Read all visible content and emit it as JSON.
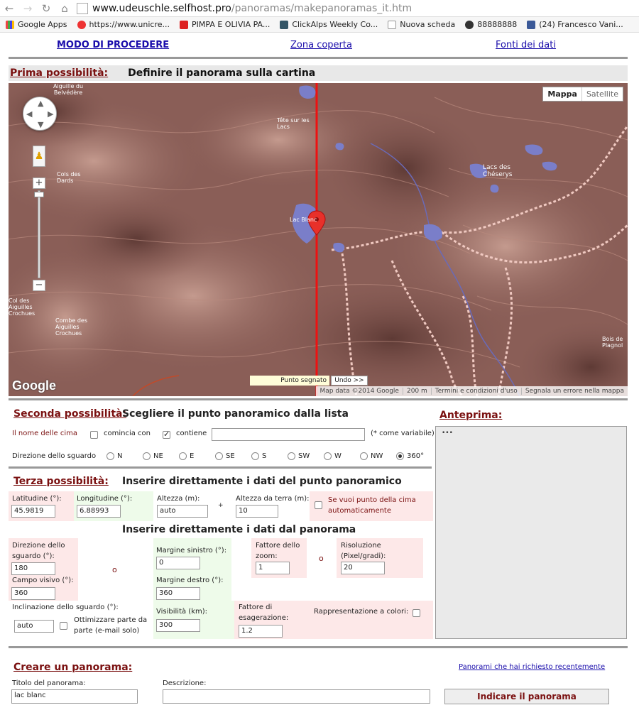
{
  "browser": {
    "url_host": "www.udeuschle.selfhost.pro",
    "url_path": "/panoramas/makepanoramas_it.htm",
    "bookmarks": [
      {
        "label": "Google Apps",
        "icon": "apps-grid-icon",
        "color": "#e44"
      },
      {
        "label": "https://www.unicre...",
        "icon": "no-entry-icon",
        "color": "#e33"
      },
      {
        "label": "PIMPA E OLIVIA PA...",
        "icon": "youtube-icon",
        "color": "#d22"
      },
      {
        "label": "ClickAlps Weekly Co...",
        "icon": "bookmark-icon",
        "color": "#356"
      },
      {
        "label": "Nuova scheda",
        "icon": "page-icon",
        "color": "#ccc"
      },
      {
        "label": "88888888",
        "icon": "circle-icon",
        "color": "#333"
      },
      {
        "label": "(24) Francesco Vani...",
        "icon": "facebook-icon",
        "color": "#3b5998"
      }
    ]
  },
  "topnav": {
    "link1": "MODO DI PROCEDERE",
    "link2": "Zona coperta",
    "link3": "Fonti dei dati"
  },
  "section1": {
    "title": "Prima possibilità:",
    "subtitle": "Definire il panorama sulla cartina"
  },
  "map": {
    "type_map": "Mappa",
    "type_satellite": "Satellite",
    "logo": "Google",
    "punto_segnato": "Punto segnato",
    "undo": "Undo >>",
    "attribution": [
      "Map data ©2014 Google",
      "200 m",
      "Termini e condizioni d'uso",
      "Segnala un errore nella mappa"
    ],
    "place_labels": [
      {
        "text": "Aiguille du Belvédère"
      },
      {
        "text": "Tête sur les Lacs"
      },
      {
        "text": "Cols des Dards"
      },
      {
        "text": "Lacs des Chéserys"
      },
      {
        "text": "Lac Blanc"
      },
      {
        "text": "Col des Aiguilles Crochues"
      },
      {
        "text": "Combe des Aiguilles Crochues"
      },
      {
        "text": "Bois de Plagnol"
      }
    ]
  },
  "section2": {
    "title": "Seconda possibilità:",
    "subtitle": "Scegliere il punto panoramico dalla lista",
    "name_label": "Il nome delle cima",
    "opt_starts": "comincia con",
    "opt_contains": "contiene",
    "wildcard_hint": "(* come variabile)",
    "direction_label": "Direzione dello sguardo",
    "directions": [
      "N",
      "NE",
      "E",
      "SE",
      "S",
      "SW",
      "W",
      "NW",
      "360°"
    ],
    "selected_direction": "360°"
  },
  "preview": {
    "title": "Anteprima:"
  },
  "section3": {
    "title": "Terza possibilità:",
    "subtitle": "Inserire direttamente i dati del punto panoramico",
    "lat_label": "Latitudine (°):",
    "lat_value": "45.9819",
    "lon_label": "Longitudine (°):",
    "lon_value": "6.88993",
    "alt_label": "Altezza (m):",
    "alt_value": "auto",
    "plus": "+",
    "ground_label": "Altezza da terra (m):",
    "ground_value": "10",
    "auto_peak_label": "Se vuoi punto della cima automaticamente",
    "subtitle2": "Inserire direttamente i dati dal panorama",
    "dir_label": "Direzione dello sguardo (°):",
    "dir_value": "180",
    "fov_label": "Campo visivo (°):",
    "fov_value": "360",
    "or1": "o",
    "margin_left_label": "Margine sinistro (°):",
    "margin_left_value": "0",
    "margin_right_label": "Margine destro (°):",
    "margin_right_value": "360",
    "zoom_label": "Fattore dello zoom:",
    "zoom_value": "1",
    "or2": "o",
    "res_label": "Risoluzione (Pixel/gradi):",
    "res_value": "20",
    "incl_label": "Inclinazione dello sguardo (°):",
    "incl_value": "auto",
    "optimize_label": "Ottimizzare parte da parte (e-mail solo)",
    "vis_label": "Visibilità (km):",
    "vis_value": "300",
    "exag_label": "Fattore di esagerazione:",
    "exag_value": "1.2",
    "color_label": "Rappresentazione a colori:"
  },
  "create": {
    "title": "Creare un panorama:",
    "recent_link": "Panorami che hai richiesto recentemente",
    "name_label": "Titolo del panorama:",
    "name_value": "lac blanc",
    "desc_label": "Descrizione:",
    "desc_value": "",
    "submit": "Indicare il panorama"
  }
}
